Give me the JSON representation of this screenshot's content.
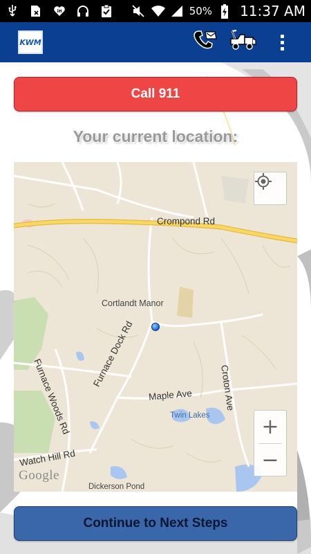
{
  "status_bar": {
    "battery": "50%",
    "time": "11:37 AM",
    "icons": [
      "usb-icon",
      "sim-blocked-icon",
      "iheart-icon",
      "headphones-icon",
      "clipboard-check-icon",
      "mute-icon",
      "wifi-icon",
      "signal-icon",
      "battery-charging-icon"
    ]
  },
  "app_bar": {
    "logo_text": "KWM",
    "actions": [
      "phone-hand-icon",
      "tow-truck-icon",
      "overflow-menu-icon"
    ],
    "color": "#0b3f91"
  },
  "call_button": {
    "label": "Call 911",
    "color": "#f04545"
  },
  "location_title": "Your current location:",
  "map": {
    "labels": {
      "crompond": "Crompond Rd",
      "cortlandt": "Cortlandt Manor",
      "furnace_dock": "Furnace Dock Rd",
      "furnace_woods": "Furnace Woods Rd",
      "maple": "Maple Ave",
      "croton": "Croton Ave",
      "twin_lakes": "Twin Lakes",
      "watch_hill": "Watch Hill Rd",
      "dickerson": "Dickerson Pond"
    },
    "attribution": "Google",
    "zoom_in": "+",
    "zoom_out": "−"
  },
  "continue_button": {
    "label": "Continue to Next Steps",
    "color": "#3a67aa"
  }
}
